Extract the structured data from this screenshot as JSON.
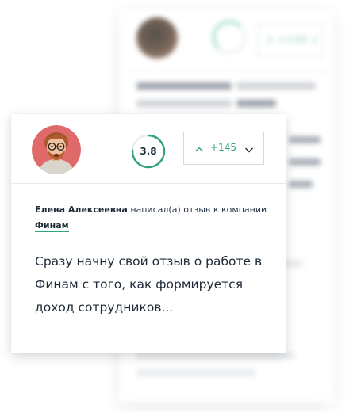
{
  "review": {
    "author": "Елена Алексеевна",
    "action": "написал(а) отзыв к компании",
    "company": "Финам",
    "rating": "3.8",
    "rating_fraction": 0.76,
    "votes": "+145",
    "text": "Сразу начну свой отзыв о работе в Финам с того, как формируется доход сотрудников..."
  },
  "colors": {
    "accent": "#2fa37c",
    "text": "#1d2a38",
    "border": "#d5dae0"
  },
  "icons": {
    "vote_up": "chevron-up-icon",
    "vote_down": "chevron-down-icon"
  }
}
